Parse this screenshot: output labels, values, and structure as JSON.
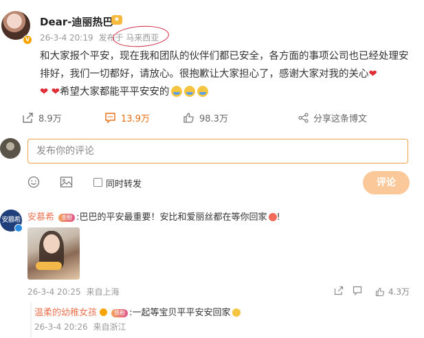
{
  "post": {
    "username": "Dear-迪丽热巴",
    "timestamp": "26-3-4 20:19",
    "location": "发布于 马来西亚",
    "text_main": "和大家报个平安，现在我和团队的伙伴们都已安全，各方面的事项公司也已经处理安排好，我们一切都好，请放心。很抱歉让大家担心了，感谢大家对我的关心",
    "text_tail": "希望大家都能平平安安的",
    "heart": "❤"
  },
  "actions": {
    "share_count": "8.9万",
    "comment_count": "13.9万",
    "like_count": "98.3万",
    "forward_label": "分享这条博文"
  },
  "composer": {
    "placeholder": "发布你的评论",
    "also_forward_label": "同时转发",
    "submit_label": "评论"
  },
  "comments": [
    {
      "avatar_text": "安慕希",
      "username": "安慕希",
      "badge": "金粉",
      "text": ":巴巴的平安最重要！安比和爱丽丝都在等你回家",
      "text_end": "!",
      "timestamp": "26-3-4 20:25",
      "location": "来自上海",
      "likes": "4.3万",
      "reply": {
        "username": "温柔的幼稚女孩",
        "badge": "铁粉",
        "text": ":一起等宝贝平平安安回家",
        "timestamp": "26-3-4 20:26",
        "location": "来自浙江"
      }
    }
  ],
  "colors": {
    "accent_orange": "#e86c13",
    "link_orange": "#eb7350",
    "annotation_red": "#d0243c",
    "submit_disabled": "#fbc89a"
  }
}
